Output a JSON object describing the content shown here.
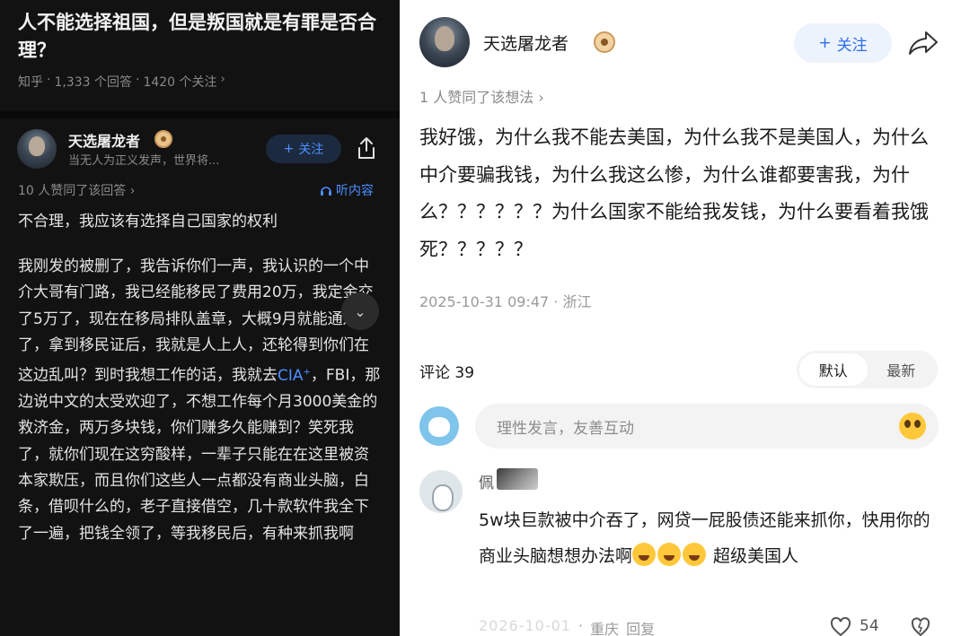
{
  "left": {
    "question_title": "人不能选择祖国，但是叛国就是有罪是否合理？",
    "question_meta": {
      "source": "知乎",
      "answers": "1,333 个回答",
      "follows": "1420 个关注",
      "chevron": "›"
    },
    "author": {
      "name": "天选屠龙者",
      "description": "当无人为正义发声，世界将...",
      "follow_label": "关注",
      "follow_plus": "+"
    },
    "likes_text": "10 人赞同了该回答 ›",
    "listen_label": "听内容",
    "answer_lead": "不合理，我应该有选择自己国家的权利",
    "answer_body_1": "我刚发的被删了，我告诉你们一声，我认识的一个中介大哥有门路，我已经能移民了费用20万，我定金交了5万了，现在在移局排队盖章，大概9月就能通过了，拿到移民证后，我就是人上人，还轮得到你们在这边乱叫？到时我想工作的话，我就去",
    "answer_cia": "CIA",
    "answer_cia_sup": "+",
    "answer_body_2": "，FBI，那边说中文的太受欢迎了，不想工作每个月3000美金的救济金，两万多块钱，你们赚多久能赚到？笑死我了，就你们现在这穷酸样，一辈子只能在在这里被资本家欺压，而且你们这些人一点都没有商业头脑，白条，借呗什么的，老子直接借空，几十款软件我全下了一遍，把钱全领了，等我移民后，有种来抓我啊",
    "expand_icon": "⌄"
  },
  "right": {
    "author": {
      "name": "天选屠龙者",
      "follow_label": "关注",
      "follow_plus": "+"
    },
    "likes_text": "1 人赞同了该想法 ›",
    "body": "我好饿，为什么我不能去美国，为什么我不是美国人，为什么中介要骗我钱，为什么我这么惨，为什么谁都要害我，为什么？？？？？？为什么国家不能给我发钱，为什么要看着我饿死？？？？？",
    "timestamp": "2025-10-31 09:47 · 浙江",
    "comments_label": "评论 39",
    "sort_options": [
      "默认",
      "最新"
    ],
    "comment_input_placeholder": "理性发言，友善互动",
    "comment": {
      "author_name": "佩",
      "body_text": "5w块巨款被中介吞了，网贷一屁股债还能来抓你，快用你的商业头脑想想办法啊",
      "body_suffix": " 超级美国人",
      "date": "2026-10-01",
      "location": "重庆",
      "reply_label": "回复",
      "like_count": "54"
    }
  },
  "colors": {
    "dark_bg": "#121212",
    "accent_blue": "#2c6de8",
    "dark_accent_blue": "#4d8fff",
    "follow_bg_light": "#edf3fd"
  }
}
